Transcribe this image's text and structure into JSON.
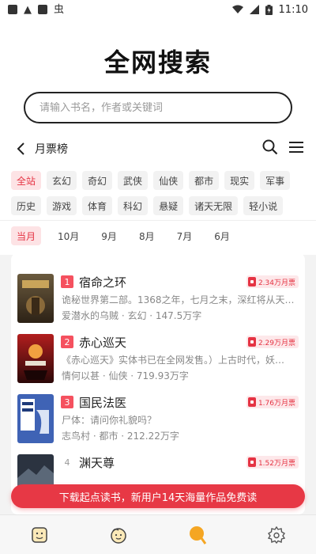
{
  "status": {
    "time": "11:10",
    "notif_glyph": "虫"
  },
  "title": "全网搜索",
  "search": {
    "placeholder": "请输入书名，作者或关键词",
    "value": ""
  },
  "ranking": {
    "title": "月票榜",
    "categories": [
      "全站",
      "玄幻",
      "奇幻",
      "武侠",
      "仙侠",
      "都市",
      "现实",
      "军事",
      "历史",
      "游戏",
      "体育",
      "科幻",
      "悬疑",
      "诸天无限",
      "轻小说"
    ],
    "active_category": "全站",
    "months": [
      "当月",
      "10月",
      "9月",
      "8月",
      "7月",
      "6月"
    ],
    "active_month": "当月"
  },
  "books": [
    {
      "rank": "1",
      "title": "宿命之环",
      "tickets": "2.34万月票",
      "desc": "诡秘世界第二部。1368之年，七月之末，深红将从天而…",
      "meta": "爱潜水的乌贼 · 玄幻 · 147.5万字"
    },
    {
      "rank": "2",
      "title": "赤心巡天",
      "tickets": "2.29万月票",
      "desc": "《赤心巡天》实体书已在全网发售。）上古时代，妖…",
      "meta": "情何以甚 · 仙侠 · 719.93万字"
    },
    {
      "rank": "3",
      "title": "国民法医",
      "tickets": "1.76万月票",
      "desc": "尸体：请问你礼貌吗？",
      "meta": "志鸟村 · 都市 · 212.22万字"
    },
    {
      "rank": "4",
      "title": "渊天尊",
      "tickets": "1.52万月票",
      "desc": "",
      "meta": ""
    }
  ],
  "promo": "下载起点读书，新用户14天海量作品免费读",
  "colors": {
    "accent": "#e53343",
    "rank1": "#f5515f",
    "rank2": "#f5515f",
    "rank3": "#f5515f",
    "tag_active_bg": "#fde3e5"
  },
  "nav_icons": [
    "bookshelf-icon",
    "discover-icon",
    "search-tab-icon",
    "settings-icon"
  ]
}
